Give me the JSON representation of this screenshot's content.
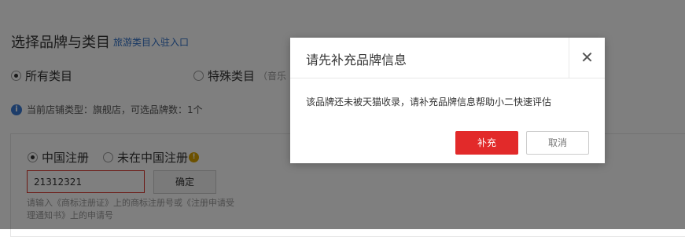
{
  "page": {
    "title": "选择品牌与类目",
    "title_link": "旅游类目入驻入口",
    "categories": [
      {
        "label": "所有类目",
        "checked": true
      },
      {
        "label": "特殊类目",
        "sub": "（音乐",
        "checked": false
      }
    ],
    "info_text": "当前店铺类型：旗舰店，可选品牌数：1个",
    "registration": [
      {
        "label": "中国注册",
        "checked": true
      },
      {
        "label": "未在中国注册",
        "checked": false
      }
    ],
    "brand_input_value": "21312321",
    "confirm_label": "确定",
    "hint": "请输入《商标注册证》上的商标注册号或《注册申请受理通知书》上的申请号"
  },
  "modal": {
    "title": "请先补充品牌信息",
    "close_symbol": "✕",
    "message": "该品牌还未被天猫收录，请补充品牌信息帮助小二快速评估",
    "primary_label": "补充",
    "cancel_label": "取消"
  },
  "colors": {
    "primary": "#e22a2a",
    "link": "#2e6fc7",
    "error_border": "#d93026",
    "info_icon": "#3a7bd5",
    "warn_icon": "#d9a300"
  },
  "icons": {
    "info": "info-icon",
    "warn": "warning-icon",
    "close": "close-icon"
  }
}
